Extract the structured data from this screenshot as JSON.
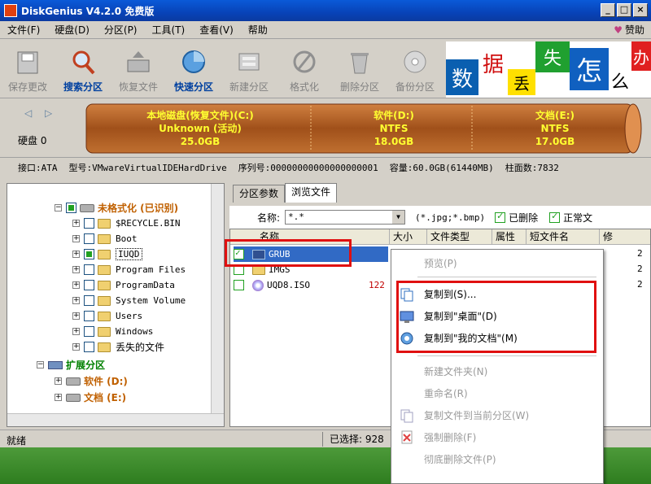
{
  "window": {
    "title": "DiskGenius V4.2.0 免费版",
    "buttons": [
      "_",
      "□",
      "×"
    ]
  },
  "menu": {
    "items": [
      "文件(F)",
      "硬盘(D)",
      "分区(P)",
      "工具(T)",
      "查看(V)",
      "帮助"
    ],
    "sponsor": "赞助"
  },
  "toolbar": {
    "items": [
      "保存更改",
      "搜索分区",
      "恢复文件",
      "快速分区",
      "新建分区",
      "格式化",
      "删除分区",
      "备份分区"
    ]
  },
  "banner": {
    "chars": [
      "数",
      "据",
      "丢",
      "失",
      "怎",
      "么",
      "办"
    ]
  },
  "disk": {
    "label": "硬盘 0",
    "partitions": [
      {
        "name": "本地磁盘(恢复文件)(C:)",
        "fs": "Unknown (活动)",
        "size": "25.0GB"
      },
      {
        "name": "软件(D:)",
        "fs": "NTFS",
        "size": "18.0GB"
      },
      {
        "name": "文档(E:)",
        "fs": "NTFS",
        "size": "17.0GB"
      }
    ]
  },
  "info": {
    "interface": "接口:ATA",
    "model": "型号:VMwareVirtualIDEHardDrive",
    "serial": "序列号:00000000000000000001",
    "capacity": "容量:60.0GB(61440MB)",
    "cylinders": "柱面数:7832"
  },
  "tree": {
    "root": "未格式化 (已识别)",
    "folders": [
      "$RECYCLE.BIN",
      "Boot",
      "IUQD",
      "Program Files",
      "ProgramData",
      "System Volume",
      "Users",
      "Windows",
      "丢失的文件"
    ],
    "extended": "扩展分区",
    "parts": [
      "软件 (D:)",
      "文档 (E:)"
    ]
  },
  "tabs": [
    "分区参数",
    "浏览文件"
  ],
  "filter": {
    "name_label": "名称:",
    "name_value": "*.*",
    "hint": "(*.jpg;*.bmp)",
    "deleted": "已删除",
    "normal": "正常文"
  },
  "columns": [
    "名称",
    "大小",
    "文件类型",
    "属性",
    "短文件名",
    "修"
  ],
  "files": [
    {
      "name": "GRUB",
      "size": "",
      "mod": "2"
    },
    {
      "name": "IMGS",
      "size": "",
      "mod": "2"
    },
    {
      "name": "UQD8.ISO",
      "size": "122",
      "mod": "2"
    }
  ],
  "context_menu": {
    "items": [
      {
        "label": "预览(P)",
        "enabled": false
      },
      {
        "label": "复制到(S)...",
        "enabled": true
      },
      {
        "label": "复制到\"桌面\"(D)",
        "enabled": true
      },
      {
        "label": "复制到\"我的文档\"(M)",
        "enabled": true
      },
      {
        "label": "新建文件夹(N)",
        "enabled": false
      },
      {
        "label": "重命名(R)",
        "enabled": false
      },
      {
        "label": "复制文件到当前分区(W)",
        "enabled": false
      },
      {
        "label": "强制删除(F)",
        "enabled": false
      },
      {
        "label": "彻底删除文件(P)",
        "enabled": false
      }
    ]
  },
  "status": {
    "left": "就绪",
    "selected": "已选择: 928"
  },
  "colors": {
    "title": "#0843b8",
    "highlight": "#e01010",
    "partition": "#a0501a",
    "partition_text": "#ffff30"
  }
}
